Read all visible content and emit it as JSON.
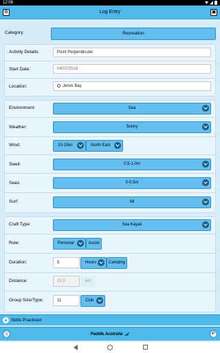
{
  "status": {
    "time": "12:06"
  },
  "header": {
    "title": "Log Entry"
  },
  "category": {
    "label": "Category:",
    "value": "Recreation"
  },
  "details": {
    "activity_label": "Activity Details:",
    "activity_value": "Point Perpendicular",
    "start_label": "Start Date:",
    "start_value": "04/07/2018",
    "location_label": "Location:",
    "location_value": "Jervis Bay"
  },
  "conditions": {
    "environment_label": "Environment:",
    "environment_value": "Sea",
    "weather_label": "Weather:",
    "weather_value": "Sunny",
    "wind_label": "Wind:",
    "wind_speed": "10-15kn",
    "wind_dir": "North East",
    "swell_label": "Swell:",
    "swell_value": "0.5-1.0m",
    "seas_label": "Seas:",
    "seas_value": "0-0.5m",
    "surf_label": "Surf:",
    "surf_value": "Nil"
  },
  "craft": {
    "craft_label": "Craft Type:",
    "craft_value": "Sea Kayak",
    "role_label": "Role:",
    "role_value": "Personal",
    "role_toggle": "Assist",
    "duration_label": "Duration:",
    "duration_value": "5",
    "duration_unit": "Hours",
    "duration_toggle": "Camping",
    "distance_label": "Distance:",
    "distance_value": "15.5",
    "distance_unit": "km",
    "group_label": "Group Size/Type:",
    "group_value": "11",
    "group_type": "Club"
  },
  "skills": {
    "label": "Skills Practiced"
  },
  "footer": {
    "brand": "Paddle Australia"
  }
}
